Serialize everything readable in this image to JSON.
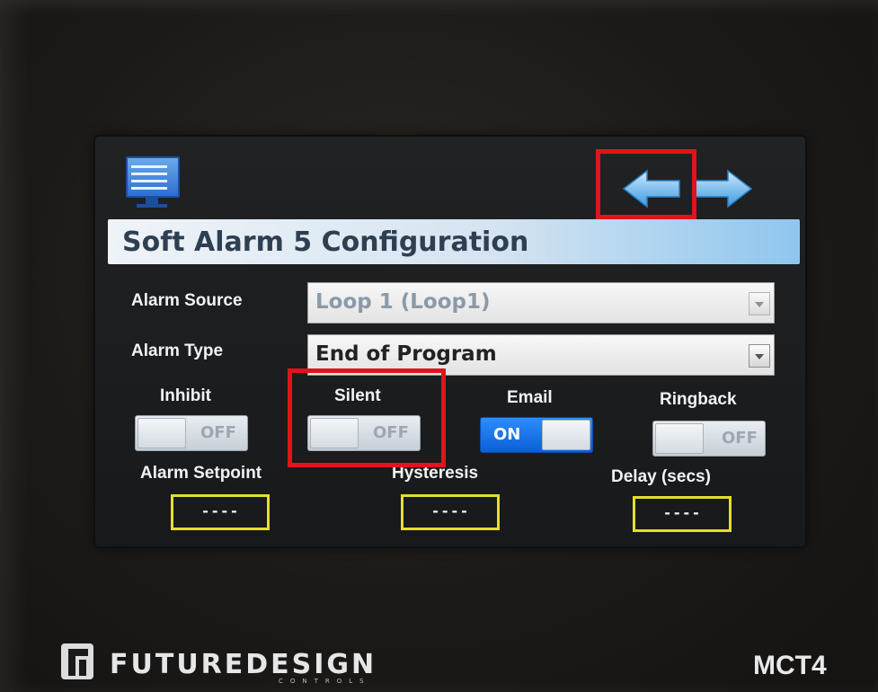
{
  "screen": {
    "title": "Soft Alarm 5 Configuration",
    "alarm_source": {
      "label": "Alarm Source",
      "value": "Loop 1 (Loop1)"
    },
    "alarm_type": {
      "label": "Alarm Type",
      "value": "End of Program"
    },
    "toggles": [
      {
        "label": "Inhibit",
        "state": "OFF"
      },
      {
        "label": "Silent",
        "state": "OFF"
      },
      {
        "label": "Email",
        "state": "ON"
      },
      {
        "label": "Ringback",
        "state": "OFF"
      }
    ],
    "fields": [
      {
        "label": "Alarm Setpoint",
        "value": "----"
      },
      {
        "label": "Hysteresis",
        "value": "----"
      },
      {
        "label": "Delay (secs)",
        "value": "----"
      }
    ],
    "icons": {
      "menu": "menu-icon",
      "back": "back-arrow-icon",
      "forward": "forward-arrow-icon"
    },
    "colors": {
      "toggle_on": "#0c6ee8",
      "highlight": "#e0141a",
      "field_border": "#e5df2a",
      "title_accent": "#8fc6ee"
    }
  },
  "device": {
    "brand": "FUTUREDESIGN",
    "brand_sub": "CONTROLS",
    "model": "MCT4"
  }
}
